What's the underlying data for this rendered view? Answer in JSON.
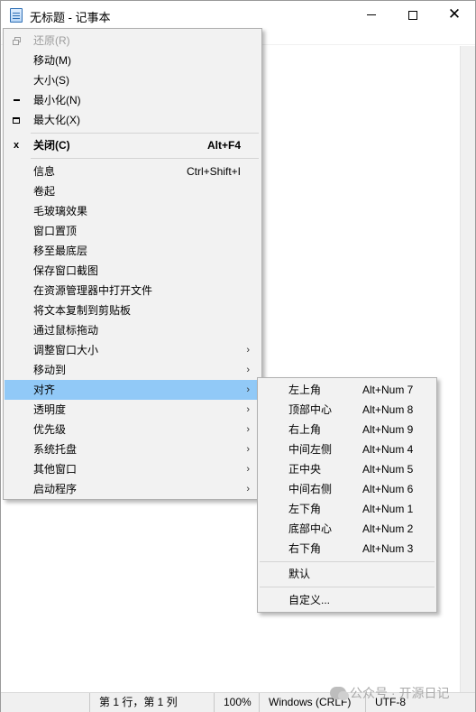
{
  "window": {
    "title": "无标题 - 记事本"
  },
  "status_bar": {
    "position": "第 1 行，第 1 列",
    "zoom": "100%",
    "line_ending": "Windows (CRLF)",
    "encoding": "UTF-8"
  },
  "watermark": {
    "text": "公众号 · 开源日记"
  },
  "system_menu": {
    "items": [
      {
        "label": "还原(R)",
        "disabled": true,
        "icon": "restore-icon"
      },
      {
        "label": "移动(M)"
      },
      {
        "label": "大小(S)"
      },
      {
        "label": "最小化(N)",
        "icon": "minimize-icon"
      },
      {
        "label": "最大化(X)",
        "icon": "maximize-icon"
      },
      {
        "label": "关闭(C)",
        "accelerator": "Alt+F4",
        "icon": "close-icon",
        "bold": true
      },
      {
        "label": "信息",
        "accelerator": "Ctrl+Shift+I"
      },
      {
        "label": "卷起"
      },
      {
        "label": "毛玻璃效果"
      },
      {
        "label": "窗口置顶"
      },
      {
        "label": "移至最底层"
      },
      {
        "label": "保存窗口截图"
      },
      {
        "label": "在资源管理器中打开文件"
      },
      {
        "label": "将文本复制到剪贴板"
      },
      {
        "label": "通过鼠标拖动"
      },
      {
        "label": "调整窗口大小",
        "submenu": true
      },
      {
        "label": "移动到",
        "submenu": true
      },
      {
        "label": "对齐",
        "submenu": true,
        "highlighted": true
      },
      {
        "label": "透明度",
        "submenu": true
      },
      {
        "label": "优先级",
        "submenu": true
      },
      {
        "label": "系统托盘",
        "submenu": true
      },
      {
        "label": "其他窗口",
        "submenu": true
      },
      {
        "label": "启动程序",
        "submenu": true
      }
    ]
  },
  "align_submenu": {
    "items": [
      {
        "label": "左上角",
        "accelerator": "Alt+Num 7"
      },
      {
        "label": "顶部中心",
        "accelerator": "Alt+Num 8"
      },
      {
        "label": "右上角",
        "accelerator": "Alt+Num 9"
      },
      {
        "label": "中间左侧",
        "accelerator": "Alt+Num 4"
      },
      {
        "label": "正中央",
        "accelerator": "Alt+Num 5"
      },
      {
        "label": "中间右侧",
        "accelerator": "Alt+Num 6"
      },
      {
        "label": "左下角",
        "accelerator": "Alt+Num 1"
      },
      {
        "label": "底部中心",
        "accelerator": "Alt+Num 2"
      },
      {
        "label": "右下角",
        "accelerator": "Alt+Num 3"
      },
      {
        "label": "默认"
      },
      {
        "label": "自定义..."
      }
    ]
  },
  "colors": {
    "highlight": "#91c9f7",
    "menu_background": "#f2f2f2"
  }
}
